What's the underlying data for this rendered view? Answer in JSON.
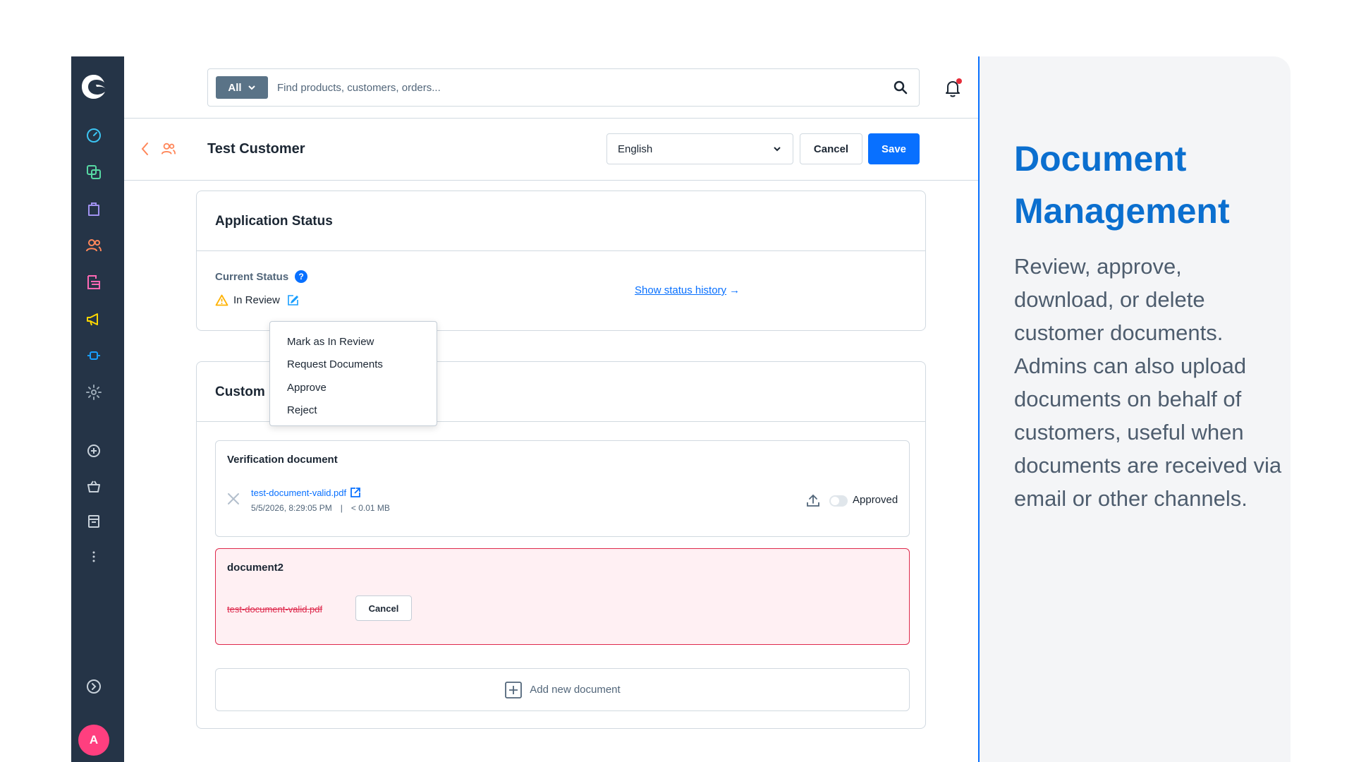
{
  "search": {
    "scope_label": "All",
    "placeholder": "Find products, customers, orders..."
  },
  "header": {
    "title": "Test Customer",
    "language": "English",
    "cancel_label": "Cancel",
    "save_label": "Save"
  },
  "sidebar": {
    "items": [
      {
        "icon": "dashboard-icon",
        "color": "#3cc4f2"
      },
      {
        "icon": "catalogues-icon",
        "color": "#57d9a3"
      },
      {
        "icon": "orders-icon",
        "color": "#a092f0"
      },
      {
        "icon": "customers-icon",
        "color": "#ff875a"
      },
      {
        "icon": "content-icon",
        "color": "#ff68b4"
      },
      {
        "icon": "marketing-icon",
        "color": "#ffd700"
      },
      {
        "icon": "extensions-icon",
        "color": "#189eff"
      },
      {
        "icon": "settings-icon",
        "color": "#9aa8b5"
      }
    ],
    "sales_channels": [
      "add-sales-channel-icon",
      "storefront-icon",
      "headless-icon"
    ],
    "avatar_initial": "A"
  },
  "application_status": {
    "title": "Application Status",
    "current_status_label": "Current Status",
    "help_glyph": "?",
    "status_value": "In Review",
    "history_link": "Show status history",
    "history_arrow": "→",
    "menu_items": [
      "Mark as In Review",
      "Request Documents",
      "Approve",
      "Reject"
    ]
  },
  "documents": {
    "title_visible": "Custom",
    "verification": {
      "title": "Verification document",
      "file_name": "test-document-valid.pdf",
      "date": "5/5/2026, 8:29:05 PM",
      "separator": "|",
      "size": "< 0.01 MB",
      "status_label": "Approved",
      "approved": false
    },
    "document2": {
      "title": "document2",
      "file_name": "test-document-valid.pdf",
      "cancel_label": "Cancel"
    },
    "add_label": "Add new document"
  },
  "marketing": {
    "title": "Document Management",
    "text": "Review, approve, download, or delete customer documents. Admins can also upload documents on behalf of customers, useful when documents are received via email or other channels."
  },
  "colors": {
    "primary": "#0870ff",
    "sidebar_bg": "#253447",
    "warning": "#ffb200",
    "danger": "#de294c",
    "panel_title": "#0b6fcf"
  }
}
